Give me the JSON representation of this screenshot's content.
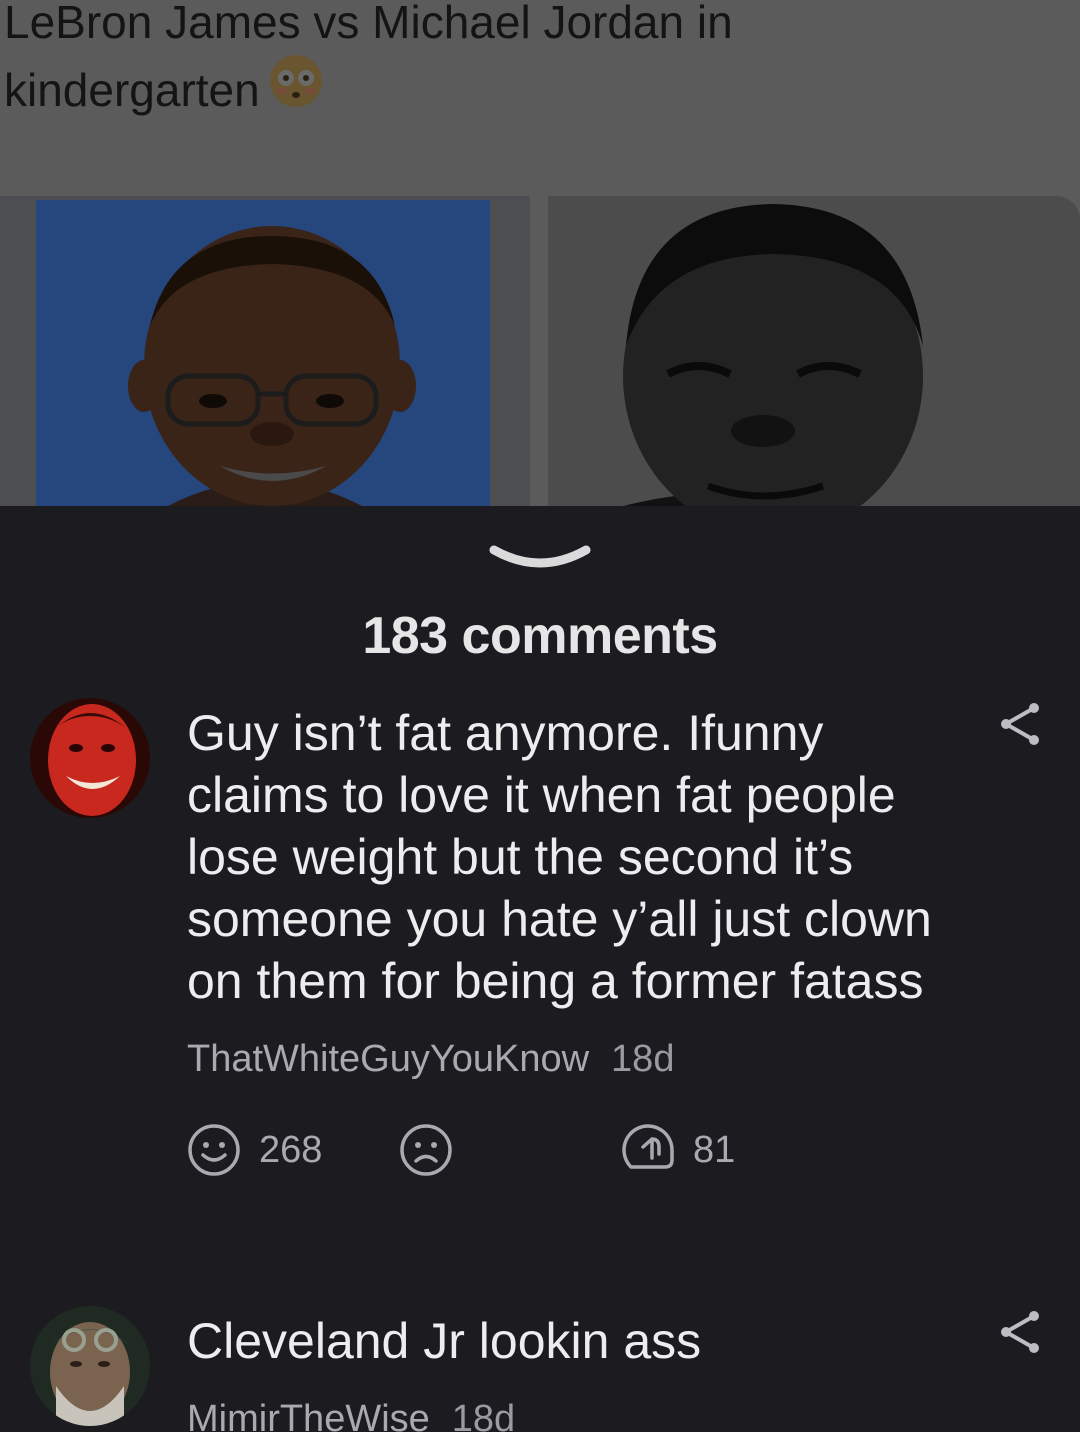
{
  "post": {
    "caption": "LeBron James vs Michael Jordan in kindergarten",
    "caption_emoji": "flushed-face-icon"
  },
  "sheet": {
    "collapse_icon": "chevron-down-icon",
    "comments_count": "183 comments"
  },
  "comments": [
    {
      "text": "Guy isn’t fat anymore. Ifunny claims to love it when fat people lose weight but the second it’s someone you hate y’all just clown on them for being a former fatass",
      "author": "ThatWhiteGuyYouKnow",
      "age": "18d",
      "smiles": "268",
      "replies": "81",
      "avatar_color": "#c8281e"
    },
    {
      "text": "Cleveland Jr lookin ass",
      "author": "MimirTheWise",
      "age": "18d",
      "avatar_color": "#6b5a48"
    }
  ],
  "icons": {
    "share": "share-icon",
    "smile": "smile-icon",
    "unsmile": "unsmile-icon",
    "reply": "reply-icon"
  },
  "colors": {
    "sheet_bg": "#1b1b20",
    "text_primary": "#ededed",
    "text_secondary": "#a9a9b0"
  }
}
